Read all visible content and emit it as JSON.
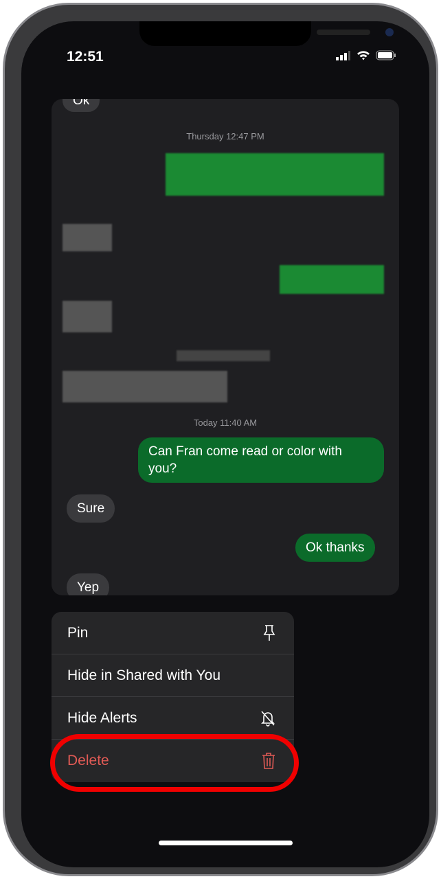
{
  "status_bar": {
    "time": "12:51",
    "icons": [
      "cellular-signal-icon",
      "wifi-icon",
      "battery-icon"
    ]
  },
  "conversation": {
    "timestamps": [
      "Thursday 12:47 PM",
      "Today 11:40 AM"
    ],
    "messages": [
      {
        "dir": "in",
        "text": "Ok"
      },
      {
        "dir": "out",
        "text": "Can Fran come read or color with you?"
      },
      {
        "dir": "in",
        "text": "Sure"
      },
      {
        "dir": "out",
        "text": "Ok thanks"
      },
      {
        "dir": "in",
        "text": "Yep"
      }
    ]
  },
  "menu": {
    "items": [
      {
        "label": "Pin",
        "icon": "pin-icon"
      },
      {
        "label": "Hide in Shared with You",
        "icon": ""
      },
      {
        "label": "Hide Alerts",
        "icon": "bell-slash-icon"
      },
      {
        "label": "Delete",
        "icon": "trash-icon"
      }
    ]
  },
  "colors": {
    "outgoing": "#0b6b2a",
    "incoming": "#3a3a3d",
    "delete": "#e05a55",
    "highlight": "#f00000"
  }
}
